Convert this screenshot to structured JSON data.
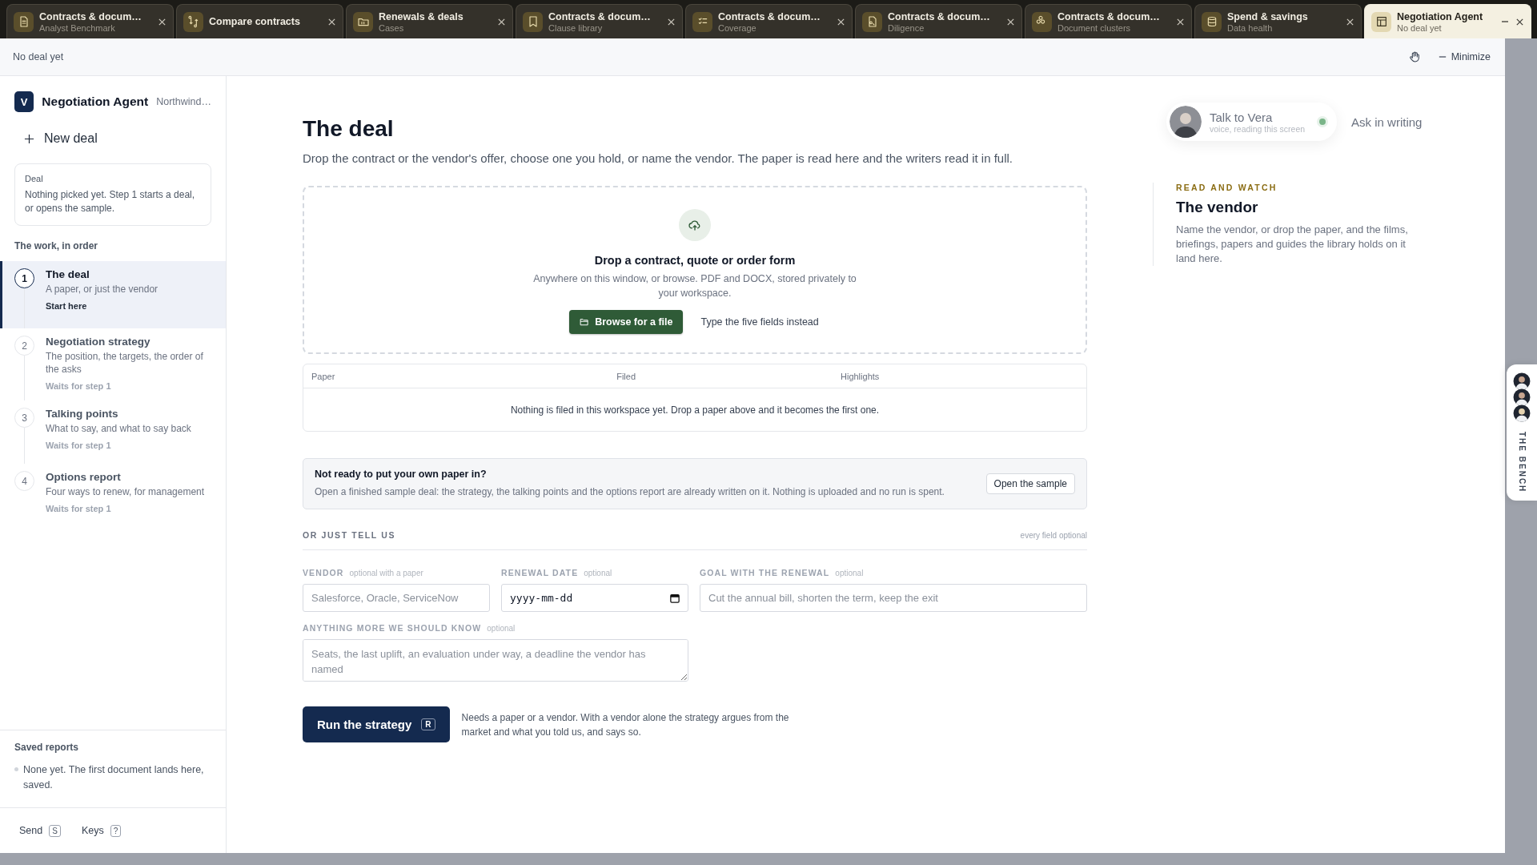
{
  "tabs": [
    {
      "title": "Contracts & docum…",
      "subtitle": "Analyst Benchmark",
      "selected": false
    },
    {
      "title": "Compare contracts",
      "selected": false
    },
    {
      "title": "Renewals & deals",
      "subtitle": "Cases",
      "selected": false
    },
    {
      "title": "Contracts & docum…",
      "subtitle": "Clause library",
      "selected": false
    },
    {
      "title": "Contracts & docum…",
      "subtitle": "Coverage",
      "selected": false
    },
    {
      "title": "Contracts & docum…",
      "subtitle": "Diligence",
      "selected": false
    },
    {
      "title": "Contracts & docum…",
      "subtitle": "Document clusters",
      "selected": false
    },
    {
      "title": "Spend & savings",
      "subtitle": "Data health",
      "selected": false
    },
    {
      "title": "Negotiation Agent",
      "subtitle": "No deal yet",
      "selected": true
    }
  ],
  "window": {
    "status": "No deal yet",
    "minimize": "Minimize"
  },
  "sidebar": {
    "badge": "V",
    "app_name": "Negotiation Agent",
    "workspace": "Northwind…",
    "new_deal": "New deal",
    "deal_card": {
      "label": "Deal",
      "text": "Nothing picked yet. Step 1 starts a deal, or opens the sample."
    },
    "steps_heading": "The work, in order",
    "steps": [
      {
        "number": "1",
        "title": "The deal",
        "description": "A paper, or just the vendor",
        "status": "Start here",
        "selected": true
      },
      {
        "number": "2",
        "title": "Negotiation strategy",
        "description": "The position, the targets, the order of the asks",
        "status": "Waits for step 1",
        "selected": false
      },
      {
        "number": "3",
        "title": "Talking points",
        "description": "What to say, and what to say back",
        "status": "Waits for step 1",
        "selected": false
      },
      {
        "number": "4",
        "title": "Options report",
        "description": "Four ways to renew, for management",
        "status": "Waits for step 1",
        "selected": false
      }
    ],
    "saved_heading": "Saved reports",
    "saved_items": [
      "None yet. The first document lands here, saved."
    ],
    "shortcuts": [
      {
        "label": "Send",
        "key": "S"
      },
      {
        "label": "Keys",
        "key": "?"
      }
    ]
  },
  "main": {
    "title": "The deal",
    "intro": "Drop the contract or the vendor's offer, choose one you hold, or name the vendor. The paper is read here and the writers read it in full.",
    "dropzone": {
      "title": "Drop a contract, quote or order form",
      "text": "Anywhere on this window, or browse. PDF and DOCX, stored privately to your workspace.",
      "browse": "Browse for a file",
      "alternative": "Type the five fields instead"
    },
    "table": {
      "columns": [
        "Paper",
        "Filed",
        "Highlights"
      ],
      "empty": "Nothing is filed in this workspace yet. Drop a paper above and it becomes the first one."
    },
    "sample": {
      "title": "Not ready to put your own paper in?",
      "text": "Open a finished sample deal: the strategy, the talking points and the options report are already written on it. Nothing is uploaded and no run is spent.",
      "button": "Open the sample"
    },
    "form": {
      "heading": "OR JUST TELL US",
      "note": "every field optional",
      "fields": [
        {
          "kind": "text",
          "label": "VENDOR",
          "hint": "optional with a paper",
          "placeholder": "Salesforce, Oracle, ServiceNow"
        },
        {
          "kind": "date",
          "label": "RENEWAL DATE",
          "hint": "optional",
          "value": "yyyy-mm-dd"
        },
        {
          "kind": "text",
          "label": "GOAL WITH THE RENEWAL",
          "hint": "optional",
          "placeholder": "Cut the annual bill, shorten the term, keep the exit"
        },
        {
          "kind": "textarea",
          "label": "ANYTHING MORE WE SHOULD KNOW",
          "hint": "optional",
          "placeholder": "Seats, the last uplift, an evaluation under way, a deadline the vendor has named"
        }
      ]
    },
    "run": {
      "label": "Run the strategy",
      "key": "R",
      "note": "Needs a paper or a vendor. With a vendor alone the strategy argues from the market and what you told us, and says so."
    }
  },
  "assistant": {
    "name": "Talk to Vera",
    "subtitle": "voice, reading this screen",
    "ask": "Ask in writing"
  },
  "read_and_watch": {
    "eyebrow": "READ AND WATCH",
    "title": "The vendor",
    "text": "Name the vendor, or drop the paper, and the films, briefings, papers and guides the library holds on it land here."
  },
  "bench": {
    "label": "THE BENCH"
  }
}
